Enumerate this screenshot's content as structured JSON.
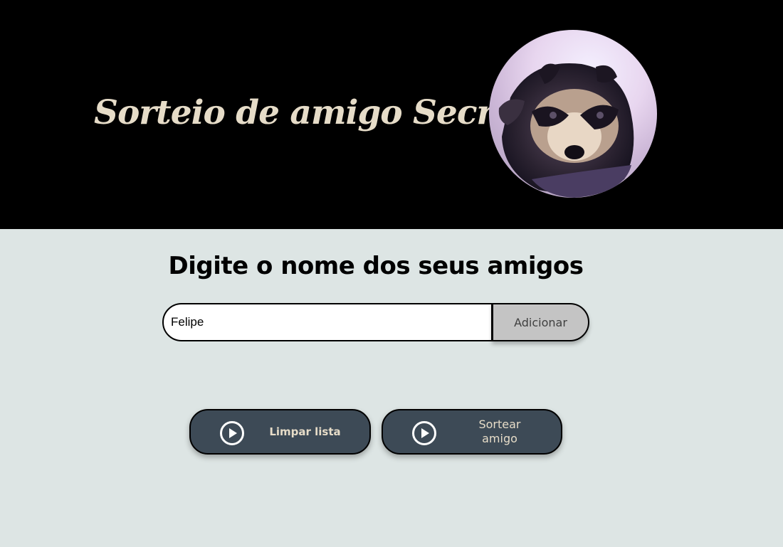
{
  "header": {
    "title": "Sorteio de amigo Secreto",
    "avatar_icon": "raccoon-avatar-image"
  },
  "main": {
    "section_title": "Digite o nome dos seus amigos",
    "name_input": {
      "value": "Felipe",
      "placeholder": ""
    },
    "add_button_label": "Adicionar",
    "clear_button_label": "Limpar lista",
    "draw_button_label": "Sortear amigo",
    "button_icon": "play-circle-icon"
  },
  "colors": {
    "header_bg": "#000000",
    "title_text": "#e6dcc8",
    "page_bg": "#dde5e4",
    "button_bg": "#3d4a56",
    "add_button_bg": "#c4c4c4"
  }
}
